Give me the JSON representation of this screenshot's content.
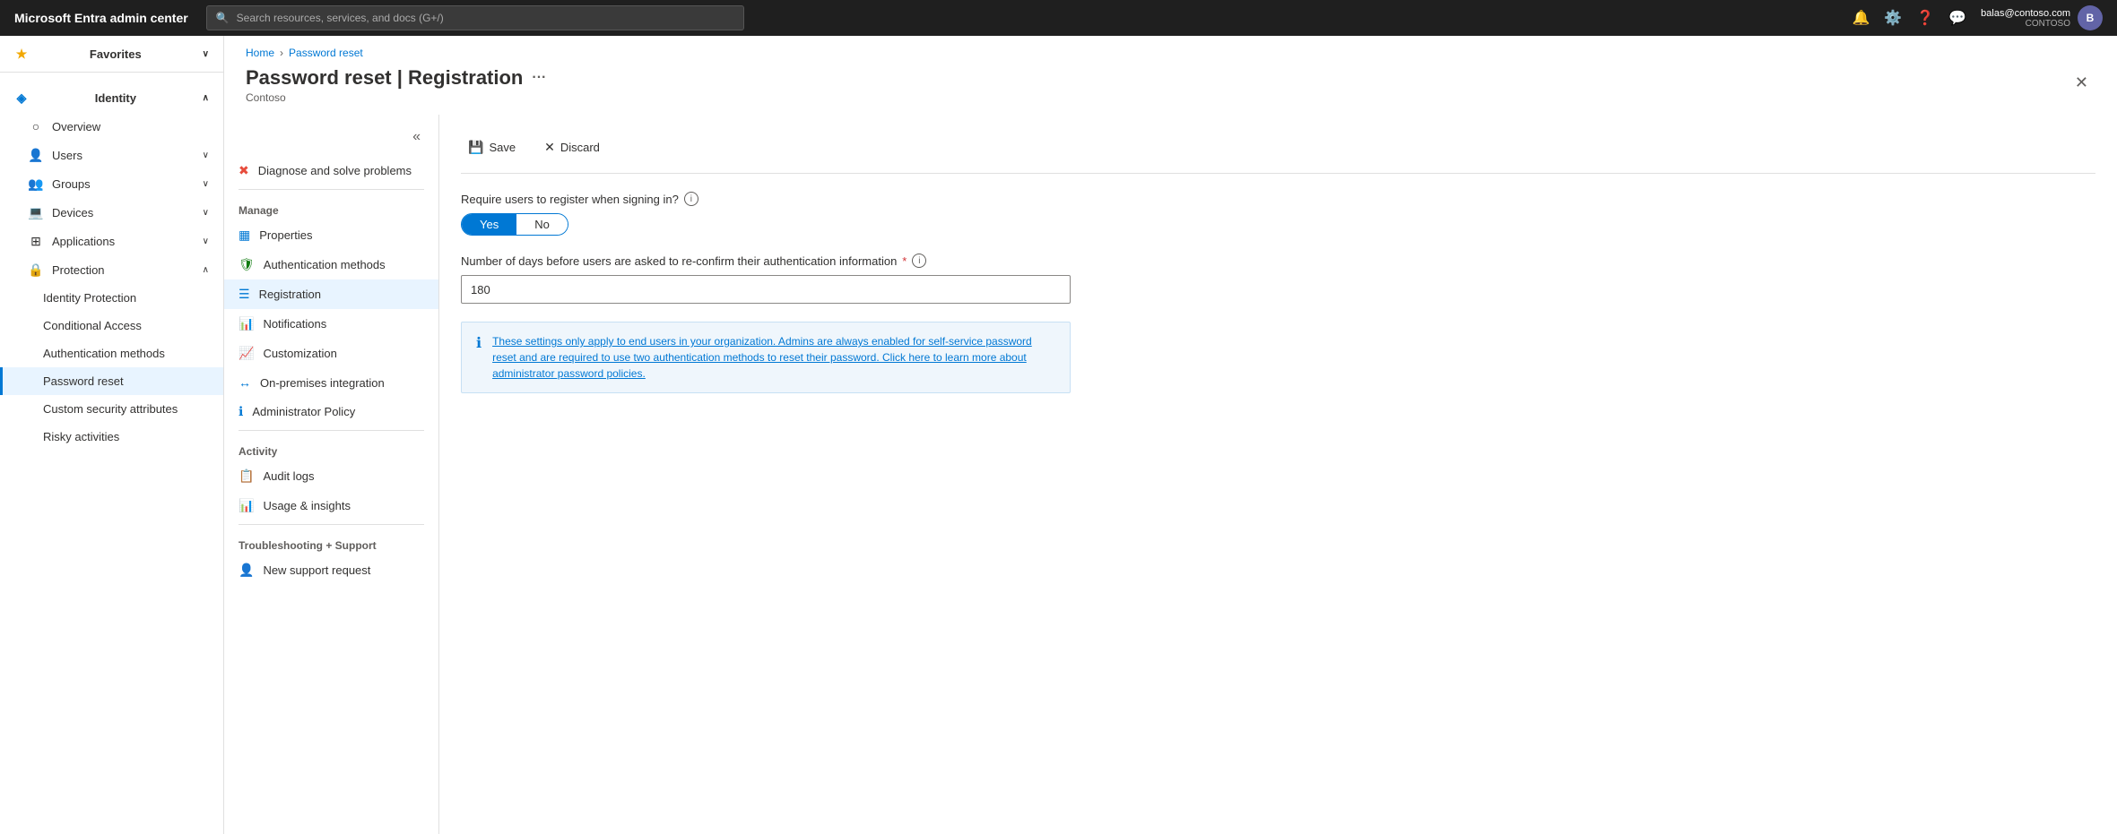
{
  "topbar": {
    "brand": "Microsoft Entra admin center",
    "search_placeholder": "Search resources, services, and docs (G+/)",
    "user_email": "balas@contoso.com",
    "user_org": "CONTOSO",
    "user_initials": "B"
  },
  "sidebar": {
    "favorites_label": "Favorites",
    "identity_label": "Identity",
    "overview_label": "Overview",
    "users_label": "Users",
    "groups_label": "Groups",
    "devices_label": "Devices",
    "applications_label": "Applications",
    "protection_label": "Protection",
    "sub_items": [
      "Identity Protection",
      "Conditional Access",
      "Authentication methods",
      "Password reset",
      "Custom security attributes",
      "Risky activities"
    ]
  },
  "breadcrumb": {
    "home": "Home",
    "page": "Password reset"
  },
  "page": {
    "title": "Password reset | Registration",
    "subtitle": "Contoso",
    "more_icon": "···",
    "close_icon": "✕"
  },
  "panel_nav": {
    "diagnose_label": "Diagnose and solve problems",
    "manage_label": "Manage",
    "manage_items": [
      {
        "label": "Properties",
        "icon": "bar"
      },
      {
        "label": "Authentication methods",
        "icon": "shield"
      },
      {
        "label": "Registration",
        "icon": "list",
        "active": true
      },
      {
        "label": "Notifications",
        "icon": "bell"
      },
      {
        "label": "Customization",
        "icon": "chart"
      },
      {
        "label": "On-premises integration",
        "icon": "arrows"
      },
      {
        "label": "Administrator Policy",
        "icon": "info"
      }
    ],
    "activity_label": "Activity",
    "activity_items": [
      {
        "label": "Audit logs",
        "icon": "log"
      },
      {
        "label": "Usage & insights",
        "icon": "bar2"
      }
    ],
    "troubleshoot_label": "Troubleshooting + Support",
    "troubleshoot_items": [
      {
        "label": "New support request",
        "icon": "person"
      }
    ]
  },
  "toolbar": {
    "save_label": "Save",
    "discard_label": "Discard"
  },
  "form": {
    "require_register_label": "Require users to register when signing in?",
    "yes_label": "Yes",
    "no_label": "No",
    "days_label": "Number of days before users are asked to re-confirm their authentication information",
    "days_value": "180",
    "info_text": "These settings only apply to end users in your organization. Admins are always enabled for self-service password reset and are required to use two authentication methods to reset their password. Click here to learn more about administrator password policies."
  }
}
